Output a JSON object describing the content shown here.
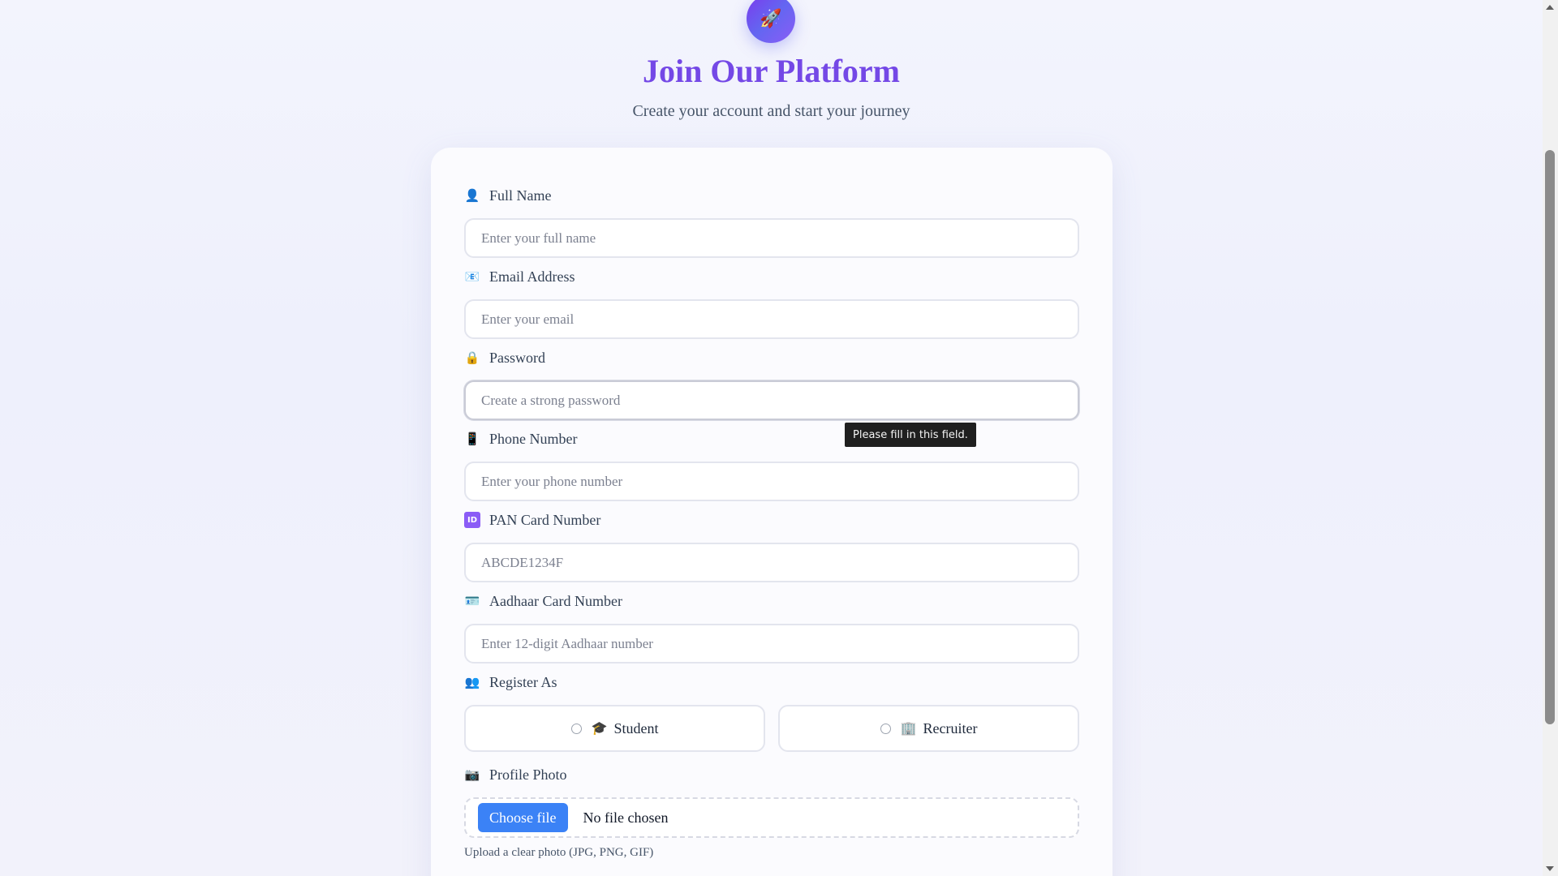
{
  "header": {
    "logo_icon": "🚀",
    "title": "Join Our Platform",
    "subtitle": "Create your account and start your journey"
  },
  "form": {
    "full_name": {
      "icon": "👤",
      "label": "Full Name",
      "placeholder": "Enter your full name",
      "value": ""
    },
    "email": {
      "icon": "📧",
      "label": "Email Address",
      "placeholder": "Enter your email",
      "value": ""
    },
    "password": {
      "icon": "🔒",
      "label": "Password",
      "placeholder": "Create a strong password",
      "value": ""
    },
    "phone": {
      "icon": "📱",
      "label": "Phone Number",
      "placeholder": "Enter your phone number",
      "value": ""
    },
    "pan": {
      "icon": "ID",
      "label": "PAN Card Number",
      "placeholder": "ABCDE1234F",
      "value": ""
    },
    "aadhaar": {
      "icon": "🪪",
      "label": "Aadhaar Card Number",
      "placeholder": "Enter 12-digit Aadhaar number",
      "value": ""
    },
    "register_as": {
      "icon": "👥",
      "label": "Register As",
      "options": [
        {
          "icon": "🎓",
          "label": "Student",
          "selected": false
        },
        {
          "icon": "🏢",
          "label": "Recruiter",
          "selected": false
        }
      ]
    },
    "profile_photo": {
      "icon": "📷",
      "label": "Profile Photo",
      "button_label": "Choose file",
      "status": "No file chosen",
      "hint": "Upload a clear photo (JPG, PNG, GIF)"
    }
  },
  "tooltip": {
    "text": "Please fill in this field."
  },
  "colors": {
    "title": "#7448e6",
    "accent_button": "#3b82f6",
    "logo_gradient_start": "#7c3aed",
    "logo_gradient_end": "#8b5cf6"
  }
}
